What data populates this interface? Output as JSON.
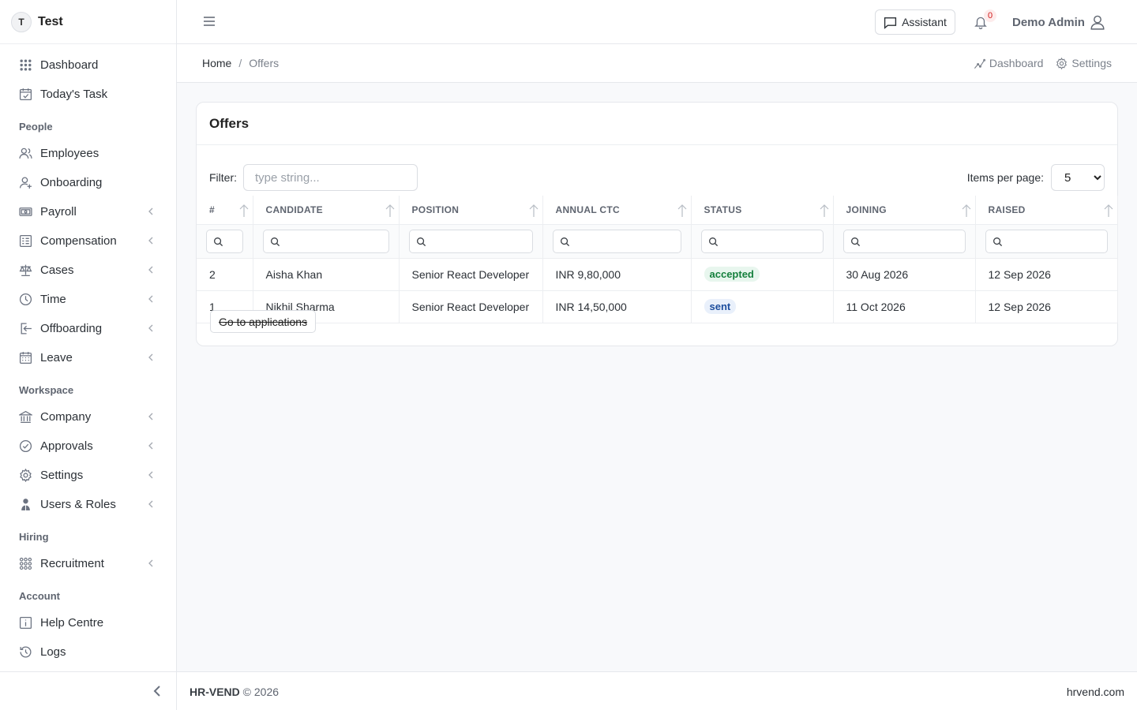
{
  "brand": {
    "initial": "T",
    "name": "Test"
  },
  "sidebar": {
    "items": [
      {
        "label": "Dashboard",
        "icon": "grid-icon"
      },
      {
        "label": "Today's Task",
        "icon": "calendar-check-icon"
      }
    ],
    "sections": [
      {
        "title": "People",
        "items": [
          {
            "label": "Employees",
            "icon": "users-icon"
          },
          {
            "label": "Onboarding",
            "icon": "user-plus-icon"
          },
          {
            "label": "Payroll",
            "icon": "money-icon"
          },
          {
            "label": "Compensation",
            "icon": "table-icon"
          },
          {
            "label": "Cases",
            "icon": "scale-icon"
          },
          {
            "label": "Time",
            "icon": "clock-icon"
          },
          {
            "label": "Offboarding",
            "icon": "logout-icon"
          },
          {
            "label": "Leave",
            "icon": "calendar-icon"
          }
        ]
      },
      {
        "title": "Workspace",
        "items": [
          {
            "label": "Company",
            "icon": "bank-icon"
          },
          {
            "label": "Approvals",
            "icon": "check-circle-icon"
          },
          {
            "label": "Settings",
            "icon": "gear-icon"
          },
          {
            "label": "Users & Roles",
            "icon": "user-shield-icon"
          }
        ]
      },
      {
        "title": "Hiring",
        "items": [
          {
            "label": "Recruitment",
            "icon": "grid-icon"
          }
        ]
      },
      {
        "title": "Account",
        "items": [
          {
            "label": "Help Centre",
            "icon": "info-icon"
          },
          {
            "label": "Logs",
            "icon": "history-icon"
          }
        ]
      }
    ]
  },
  "header": {
    "assistant_label": "Assistant",
    "notification_count": "0",
    "user_name": "Demo Admin"
  },
  "breadcrumb": {
    "home": "Home",
    "separator": "/",
    "current": "Offers"
  },
  "quick_links": {
    "dashboard": "Dashboard",
    "settings": "Settings"
  },
  "card": {
    "title": "Offers",
    "filter_label": "Filter:",
    "filter_placeholder": "type string...",
    "items_per_page_label": "Items per page:",
    "items_per_page_value": "5",
    "columns": [
      "#",
      "CANDIDATE",
      "POSITION",
      "ANNUAL CTC",
      "STATUS",
      "JOINING",
      "RAISED"
    ],
    "rows": [
      {
        "id": "2",
        "candidate": "Aisha Khan",
        "position": "Senior React Developer",
        "ctc": "INR 9,80,000",
        "status": "accepted",
        "joining": "30 Aug 2026",
        "raised": "12 Sep 2026"
      },
      {
        "id": "1",
        "candidate": "Nikhil Sharma",
        "position": "Senior React Developer",
        "ctc": "INR 14,50,000",
        "status": "sent",
        "joining": "11 Oct 2026",
        "raised": "12 Sep 2026"
      }
    ],
    "go_button": "Go to applications"
  },
  "footer": {
    "brand": "HR-VEND",
    "copyright": "© 2026",
    "site": "hrvend.com"
  },
  "colors": {
    "accepted_bg": "#e8f6ee",
    "accepted_fg": "#15803d",
    "sent_bg": "#e9f0fb",
    "sent_fg": "#1d4e9e",
    "alert": "#d11a1a"
  }
}
